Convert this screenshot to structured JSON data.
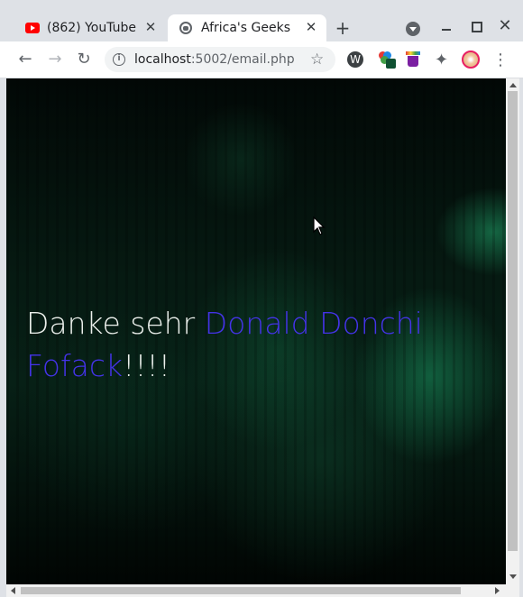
{
  "tabs": [
    {
      "title": "(862) YouTube",
      "close": "✕"
    },
    {
      "title": "Africa's Geeks",
      "close": "✕"
    }
  ],
  "toolbar": {
    "new_tab": "+",
    "back": "←",
    "forward": "→",
    "reload": "↻",
    "info": "i",
    "url_host": "localhost",
    "url_rest": ":5002/email.php",
    "star": "☆",
    "ext1": "W",
    "puzzle": "✦",
    "menu": "⋮"
  },
  "window": {
    "close": "✕"
  },
  "page": {
    "greeting": "Danke sehr",
    "name": "Donald Donchi Fofack",
    "exclaim": "!!!!"
  },
  "colors": {
    "name_accent": "#4433e8",
    "text": "#ecf0ec",
    "background": "#041610"
  }
}
